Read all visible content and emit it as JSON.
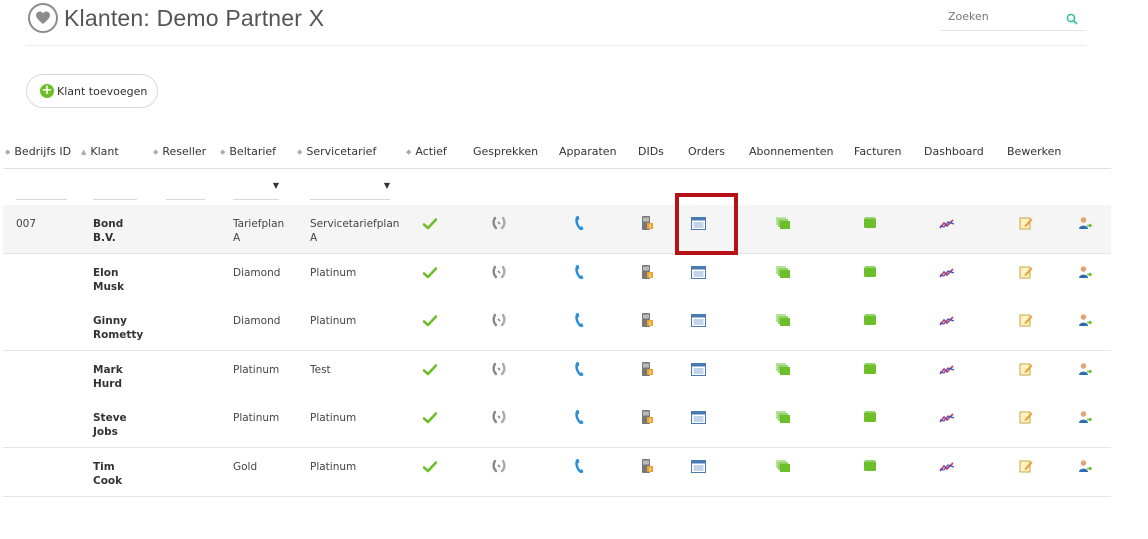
{
  "header": {
    "title": "Klanten: Demo Partner X",
    "title_icon": "heart-icon",
    "search": {
      "placeholder": "Zoeken",
      "icon": "search-icon"
    }
  },
  "toolbar": {
    "add_client_label": "Klant toevoegen",
    "add_icon": "plus-circle-icon"
  },
  "columns": [
    {
      "key": "bedrijfs_id",
      "label": "Bedrijfs ID",
      "sortable": true
    },
    {
      "key": "klant",
      "label": "Klant",
      "sortable": true,
      "sort": "asc"
    },
    {
      "key": "reseller",
      "label": "Reseller",
      "sortable": true
    },
    {
      "key": "beltarief",
      "label": "Beltarief",
      "sortable": true
    },
    {
      "key": "servicetarief",
      "label": "Servicetarief",
      "sortable": true
    },
    {
      "key": "actief",
      "label": "Actief",
      "sortable": true
    },
    {
      "key": "gesprekken",
      "label": "Gesprekken"
    },
    {
      "key": "apparaten",
      "label": "Apparaten"
    },
    {
      "key": "dids",
      "label": "DIDs"
    },
    {
      "key": "orders",
      "label": "Orders"
    },
    {
      "key": "abonnementen",
      "label": "Abonnementen"
    },
    {
      "key": "facturen",
      "label": "Facturen"
    },
    {
      "key": "dashboard",
      "label": "Dashboard"
    },
    {
      "key": "bewerken",
      "label": "Bewerken"
    }
  ],
  "filters": {
    "dropdown_caret": "▼"
  },
  "rows": [
    {
      "id": "007",
      "klant": [
        "Bond",
        "B.V."
      ],
      "reseller": "",
      "beltarief": [
        "Tariefplan",
        "A"
      ],
      "servicetarief": [
        "Servicetariefplan",
        "A"
      ],
      "actief": true,
      "selected": true
    },
    {
      "id": "",
      "klant": [
        "Elon",
        "Musk"
      ],
      "reseller": "",
      "beltarief": [
        "Diamond"
      ],
      "servicetarief": [
        "Platinum"
      ],
      "actief": true
    },
    {
      "id": "",
      "klant": [
        "Ginny",
        "Rometty"
      ],
      "reseller": "",
      "beltarief": [
        "Diamond"
      ],
      "servicetarief": [
        "Platinum"
      ],
      "actief": true
    },
    {
      "id": "",
      "klant": [
        "Mark",
        "Hurd"
      ],
      "reseller": "",
      "beltarief": [
        "Platinum"
      ],
      "servicetarief": [
        "Test"
      ],
      "actief": true
    },
    {
      "id": "",
      "klant": [
        "Steve",
        "Jobs"
      ],
      "reseller": "",
      "beltarief": [
        "Platinum"
      ],
      "servicetarief": [
        "Platinum"
      ],
      "actief": true
    },
    {
      "id": "",
      "klant": [
        "Tim",
        "Cook"
      ],
      "reseller": "",
      "beltarief": [
        "Gold"
      ],
      "servicetarief": [
        "Platinum"
      ],
      "actief": true
    }
  ],
  "row_icons": [
    "check-icon",
    "calls-icon",
    "phone-icon",
    "device-icon",
    "orders-icon",
    "subscriptions-icon",
    "invoices-icon",
    "dashboard-icon",
    "edit-icon",
    "user-switch-icon"
  ],
  "colors": {
    "accent_green": "#6cbf2a",
    "highlight": "#b51116",
    "phone_blue": "#2a8fd6"
  }
}
